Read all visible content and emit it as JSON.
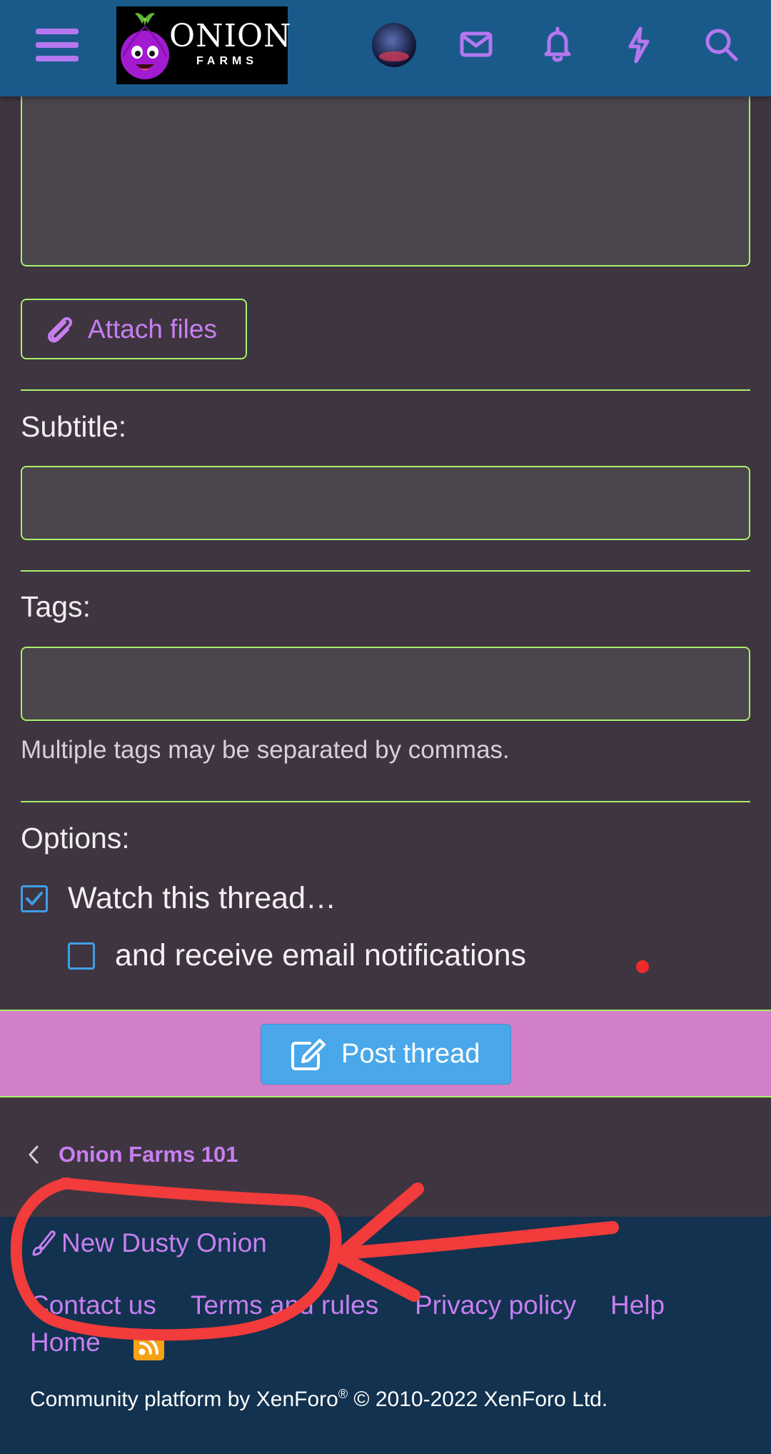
{
  "header": {
    "logo_text": "ONION",
    "logo_subtext": "FARMS",
    "icons": [
      "menu-icon",
      "avatar",
      "envelope-icon",
      "bell-icon",
      "bolt-icon",
      "search-icon"
    ],
    "accent_color": "#b577f0",
    "bar_color": "#1a5a8a"
  },
  "form": {
    "attach_label": "Attach files",
    "subtitle_label": "Subtitle:",
    "subtitle_value": "",
    "tags_label": "Tags:",
    "tags_value": "",
    "tags_hint": "Multiple tags may be separated by commas.",
    "options_label": "Options:",
    "watch_label": "Watch this thread…",
    "watch_checked": true,
    "email_label": "and receive email notifications",
    "email_checked": false,
    "border_color": "#a7f06a"
  },
  "submit": {
    "post_label": "Post thread",
    "bar_color": "#d17fc8",
    "button_color": "#4aa8ea"
  },
  "breadcrumb": {
    "label": "Onion Farms 101"
  },
  "footer": {
    "style_chooser": "New Dusty Onion",
    "links": [
      "Contact us",
      "Terms and rules",
      "Privacy policy",
      "Help",
      "Home"
    ],
    "copyright_prefix": "Community platform by XenForo",
    "copyright_mark": "®",
    "copyright_suffix": " © 2010-2022 XenForo Ltd."
  },
  "annotation": {
    "color": "#f23b3b"
  }
}
